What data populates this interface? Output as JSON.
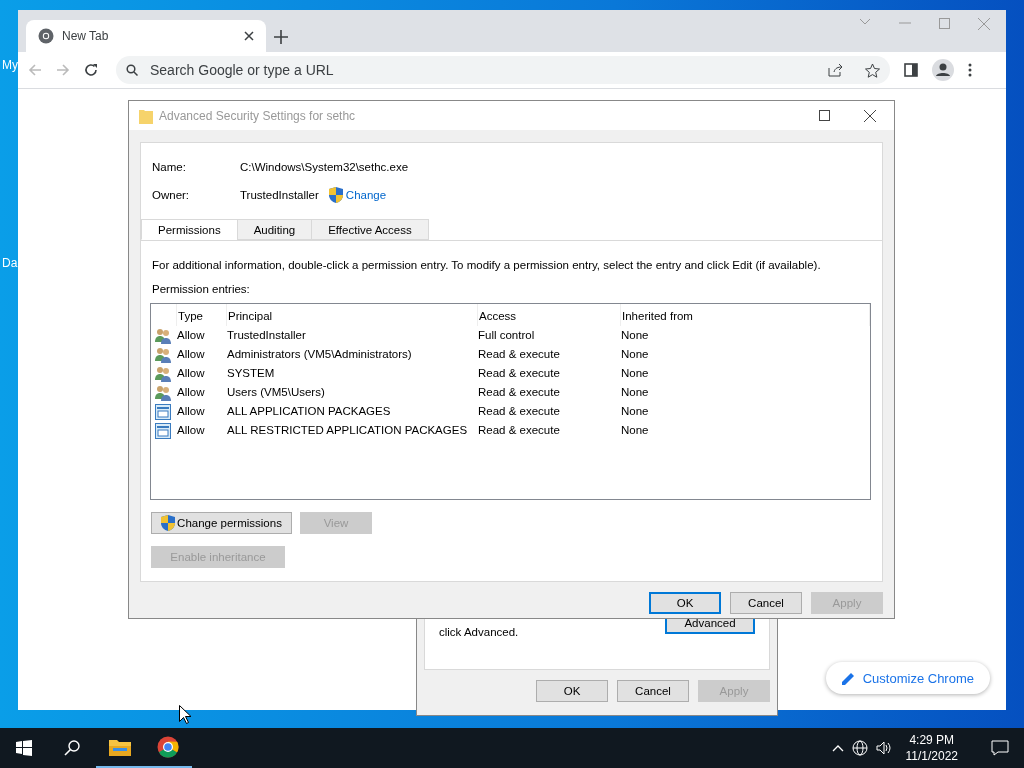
{
  "desktop": {
    "icons": [
      "My",
      "Da"
    ]
  },
  "browser": {
    "tab": {
      "title": "New Tab"
    },
    "omnibox": {
      "placeholder": "Search Google or type a URL"
    },
    "customize_button": "Customize Chrome"
  },
  "dialog": {
    "title": "Advanced Security Settings for sethc",
    "fields": [
      {
        "label": "Name:",
        "value": "C:\\Windows\\System32\\sethc.exe"
      },
      {
        "label": "Owner:",
        "value": "TrustedInstaller",
        "link": "Change"
      }
    ],
    "tabs": [
      {
        "label": "Permissions",
        "selected": true
      },
      {
        "label": "Auditing",
        "selected": false
      },
      {
        "label": "Effective Access",
        "selected": false
      }
    ],
    "info": "For additional information, double-click a permission entry. To modify a permission entry, select the entry and click Edit (if available).",
    "entries_label": "Permission entries:",
    "table": {
      "columns": [
        "Type",
        "Principal",
        "Access",
        "Inherited from"
      ],
      "rows": [
        {
          "kind": "user",
          "type": "Allow",
          "principal": "TrustedInstaller",
          "access": "Full control",
          "inherited": "None"
        },
        {
          "kind": "user",
          "type": "Allow",
          "principal": "Administrators (VM5\\Administrators)",
          "access": "Read & execute",
          "inherited": "None"
        },
        {
          "kind": "user",
          "type": "Allow",
          "principal": "SYSTEM",
          "access": "Read & execute",
          "inherited": "None"
        },
        {
          "kind": "user",
          "type": "Allow",
          "principal": "Users (VM5\\Users)",
          "access": "Read & execute",
          "inherited": "None"
        },
        {
          "kind": "package",
          "type": "Allow",
          "principal": "ALL APPLICATION PACKAGES",
          "access": "Read & execute",
          "inherited": "None"
        },
        {
          "kind": "package",
          "type": "Allow",
          "principal": "ALL RESTRICTED APPLICATION PACKAGES",
          "access": "Read & execute",
          "inherited": "None"
        }
      ]
    },
    "action_buttons": [
      {
        "label": "Change permissions",
        "shield": true,
        "disabled": false
      },
      {
        "label": "View",
        "shield": false,
        "disabled": true
      }
    ],
    "inheritance_button": {
      "label": "Enable inheritance",
      "disabled": true
    },
    "footer_buttons": [
      {
        "label": "OK",
        "default": true,
        "disabled": false
      },
      {
        "label": "Cancel",
        "default": false,
        "disabled": false
      },
      {
        "label": "Apply",
        "default": false,
        "disabled": true
      }
    ]
  },
  "back_dialog": {
    "text_lines": [
      "click Advanced."
    ],
    "advanced_button": {
      "label": "Advanced",
      "default": true
    },
    "footer_buttons": [
      {
        "label": "OK",
        "default": false,
        "disabled": false
      },
      {
        "label": "Cancel",
        "default": false,
        "disabled": false
      },
      {
        "label": "Apply",
        "default": false,
        "disabled": true
      }
    ]
  },
  "taskbar": {
    "time": "4:29 PM",
    "date": "11/1/2022"
  }
}
